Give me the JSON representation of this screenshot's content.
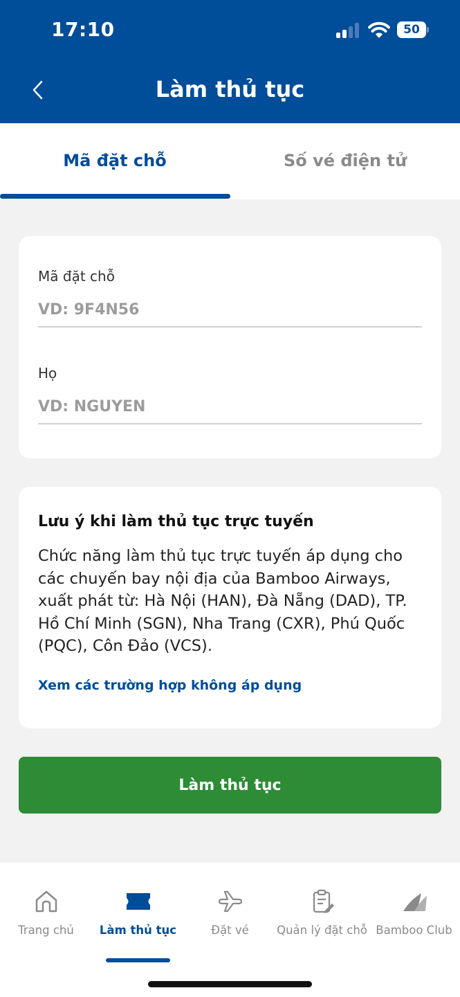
{
  "status_bar": {
    "time": "17:10",
    "battery": "50"
  },
  "header": {
    "title": "Làm thủ tục"
  },
  "tabs": [
    {
      "label": "Mã đặt chỗ",
      "active": true
    },
    {
      "label": "Số vé điện tử",
      "active": false
    }
  ],
  "form": {
    "booking_code": {
      "label": "Mã đặt chỗ",
      "placeholder": "VD: 9F4N56",
      "value": ""
    },
    "last_name": {
      "label": "Họ",
      "placeholder": "VD: NGUYEN",
      "value": ""
    }
  },
  "notice": {
    "title": "Lưu ý khi làm thủ tục trực tuyến",
    "body": "Chức năng làm thủ tục trực tuyến áp dụng cho các chuyến bay nội địa của Bamboo Airways, xuất phát từ: Hà Nội (HAN), Đà Nẵng (DAD), TP. Hồ Chí Minh (SGN), Nha Trang (CXR), Phú Quốc (PQC), Côn Đảo (VCS).",
    "link": "Xem các trường hợp không áp dụng"
  },
  "submit_button": "Làm thủ tục",
  "bottom_nav": [
    {
      "label": "Trang chủ",
      "icon": "home-icon",
      "active": false
    },
    {
      "label": "Làm thủ tục",
      "icon": "ticket-icon",
      "active": true
    },
    {
      "label": "Đặt vé",
      "icon": "plane-icon",
      "active": false
    },
    {
      "label": "Quản lý đặt chỗ",
      "icon": "clipboard-edit-icon",
      "active": false
    },
    {
      "label": "Bamboo Club",
      "icon": "bamboo-club-icon",
      "active": false
    }
  ],
  "colors": {
    "brand_blue": "#004d99",
    "action_green": "#2e8b36",
    "background": "#f2f2f2"
  }
}
